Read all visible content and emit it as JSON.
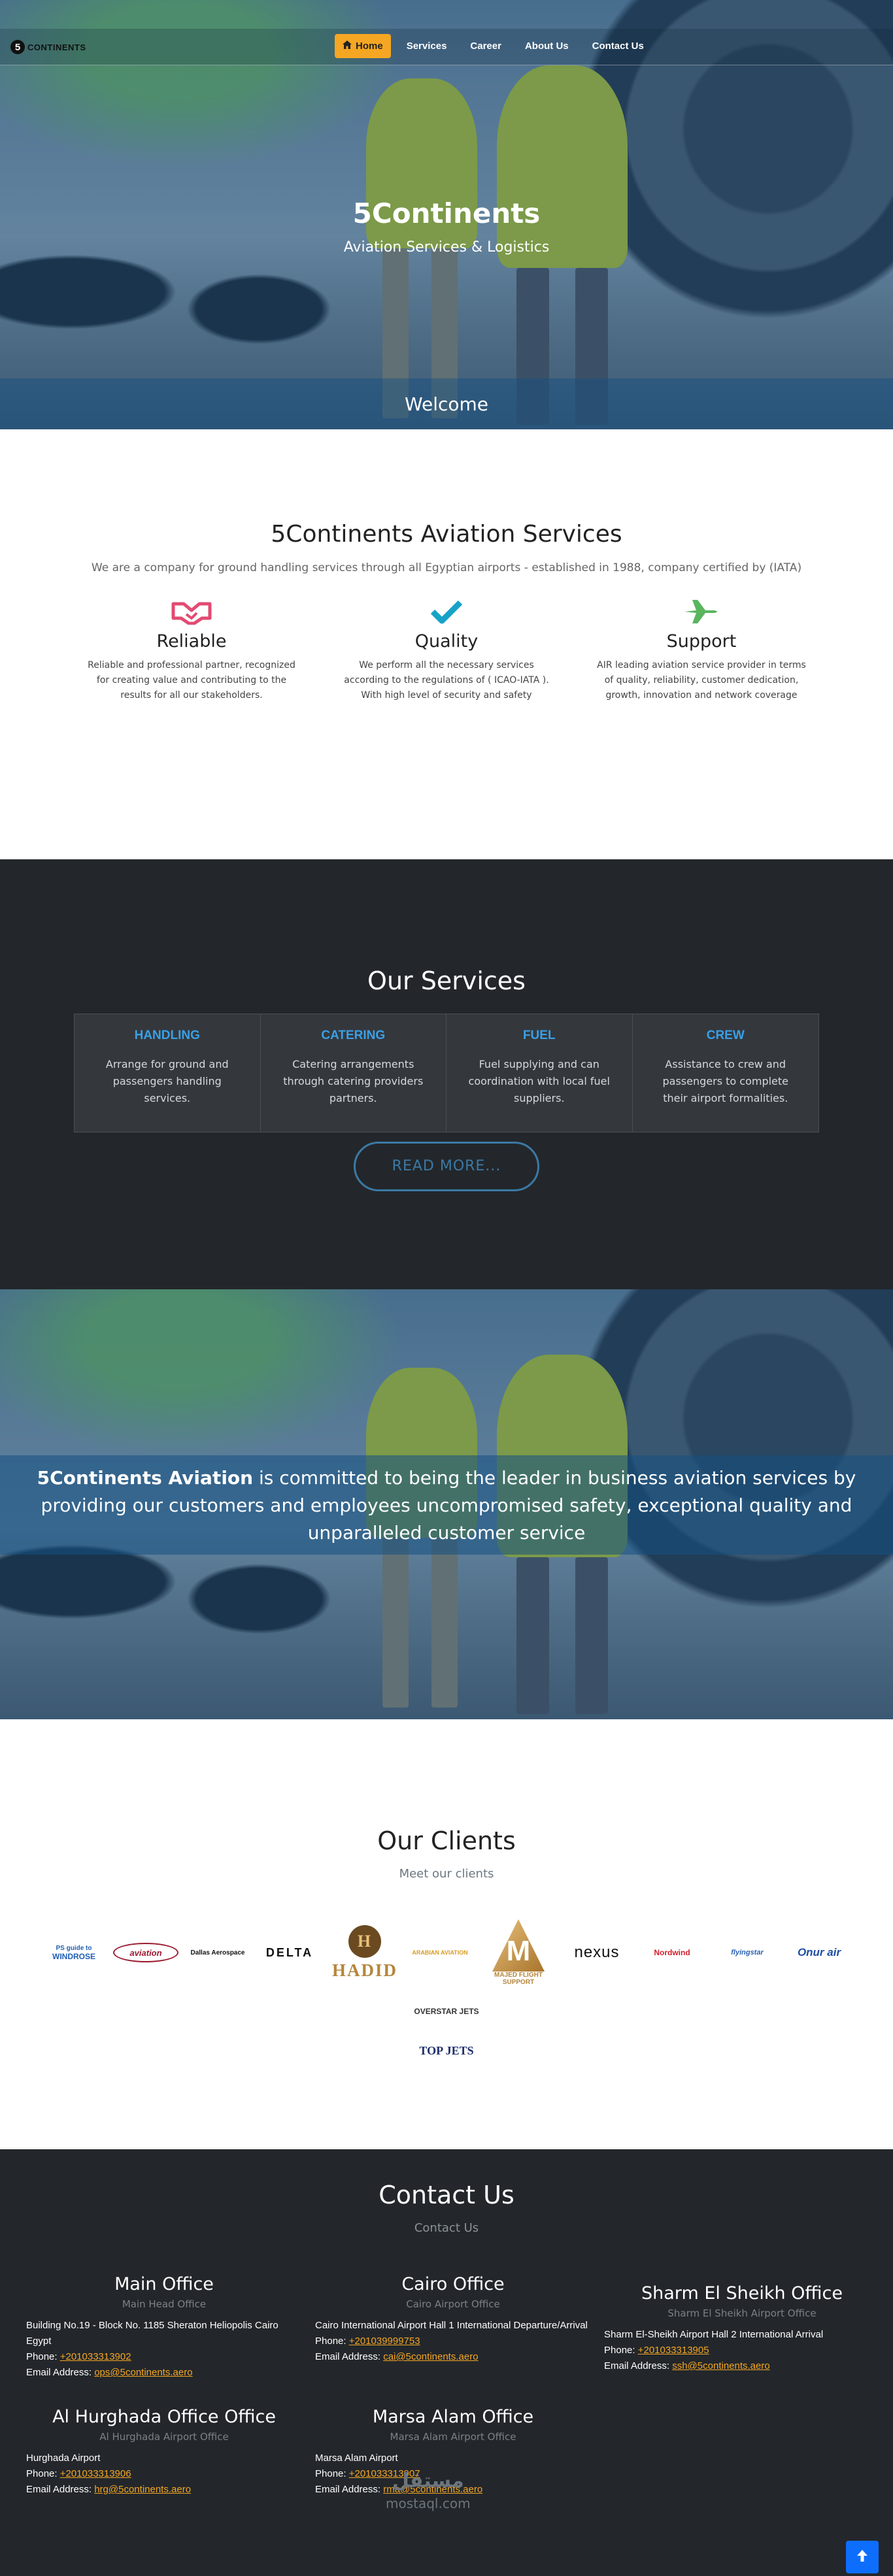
{
  "nav": {
    "logo_mark": "5",
    "logo_text": "CONTINENTS",
    "items": [
      {
        "label": "Home",
        "icon": "home-icon",
        "active": true
      },
      {
        "label": "Services"
      },
      {
        "label": "Career"
      },
      {
        "label": "About Us"
      },
      {
        "label": "Contact Us"
      }
    ]
  },
  "hero": {
    "title": "5Continents",
    "subtitle": "Aviation Services & Logistics",
    "welcome": "Welcome"
  },
  "about": {
    "title": "5Continents Aviation Services",
    "lead": "We are a company for ground handling services through all Egyptian airports - established in 1988, company certified by (IATA)",
    "features": [
      {
        "icon": "handshake-icon",
        "color": "#e24b73",
        "title": "Reliable",
        "text": "Reliable and professional partner, recognized for creating value and contributing to the results for all our stakeholders."
      },
      {
        "icon": "check-icon",
        "color": "#17a2c8",
        "title": "Quality",
        "text": "We perform all the necessary services according to the regulations of ( ICAO-IATA ). With high level of security and safety"
      },
      {
        "icon": "plane-icon",
        "color": "#5ab55e",
        "title": "Support",
        "text": "AIR leading aviation service provider in terms of quality, reliability, customer dedication, growth, innovation and network coverage"
      }
    ]
  },
  "services": {
    "title": "Our Services",
    "items": [
      {
        "title": "HANDLING",
        "text": "Arrange for ground and passengers handling services."
      },
      {
        "title": "CATERING",
        "text": "Catering arrangements through catering providers partners."
      },
      {
        "title": "FUEL",
        "text": "Fuel supplying and can coordination with local fuel suppliers."
      },
      {
        "title": "CREW",
        "text": "Assistance to crew and passengers to complete their airport formalities."
      }
    ],
    "read_more": "READ MORE..."
  },
  "mission": {
    "brand": "5Continents Aviation",
    "text": " is committed to being the leader in business aviation services by providing our customers and employees uncompromised safety, exceptional quality and unparalleled customer service"
  },
  "clients": {
    "title": "Our Clients",
    "subtitle": "Meet our clients",
    "logos": [
      {
        "name": "WINDROSE",
        "caption": "PS guide to",
        "color": "#1f5fb4"
      },
      {
        "name": "aviation",
        "caption": "",
        "color": "#9b1b30"
      },
      {
        "name": "Dallas Aerospace",
        "caption": "",
        "color": "#111111"
      },
      {
        "name": "DELTA",
        "caption": "",
        "color": "#111111"
      },
      {
        "name": "HADID",
        "caption": "H",
        "color": "#b4863c"
      },
      {
        "name": "ARABIAN AVIATION",
        "caption": "",
        "color": "#d99a22"
      },
      {
        "name": "MAJED FLIGHT SUPPORT",
        "caption": "M",
        "color": "#b4863c"
      },
      {
        "name": "nexus",
        "caption": "",
        "color": "#111111"
      },
      {
        "name": "Nordwind",
        "caption": "",
        "color": "#d41f2a"
      },
      {
        "name": "flyingstar",
        "caption": "",
        "color": "#2a62b0"
      },
      {
        "name": "Onur air",
        "caption": "",
        "color": "#1e4ea3"
      },
      {
        "name": "OVERSTAR JETS",
        "caption": "",
        "color": "#333333"
      },
      {
        "name": "TOP JETS",
        "caption": "",
        "color": "#1d2f6b"
      }
    ]
  },
  "contact": {
    "title": "Contact Us",
    "subtitle": "Contact Us",
    "offices": [
      {
        "title": "Main Office",
        "sub": "Main Head Office",
        "address": "Building No.19 - Block No. 1185 Sheraton Heliopolis Cairo Egypt",
        "phone_label": "Phone: ",
        "phone": "+201033313902",
        "email_label": "Email Address: ",
        "email": "ops@5continents.aero"
      },
      {
        "title": "Cairo Office",
        "sub": "Cairo Airport Office",
        "address": "Cairo International Airport Hall 1 International Departure/Arrival",
        "phone_label": "Phone: ",
        "phone": "+201039999753",
        "email_label": "Email Address: ",
        "email": "cai@5continents.aero"
      },
      {
        "title": "Sharm El Sheikh Office",
        "sub": "Sharm El Sheikh Airport Office",
        "address": "Sharm El-Sheikh Airport Hall 2 International Arrival",
        "phone_label": "Phone: ",
        "phone": "+201033313905",
        "email_label": "Email Address: ",
        "email": "ssh@5continents.aero"
      },
      {
        "title": "Al Hurghada Office Office",
        "sub": "Al Hurghada Airport Office",
        "address": "Hurghada Airport",
        "phone_label": "Phone: ",
        "phone": "+201033313906",
        "email_label": "Email Address: ",
        "email": "hrg@5continents.aero"
      },
      {
        "title": "Marsa Alam Office",
        "sub": "Marsa Alam Airport Office",
        "address": "Marsa Alam Airport",
        "phone_label": "Phone: ",
        "phone": "+201033313907",
        "email_label": "Email Address: ",
        "email": "rma@5continents.aero"
      }
    ]
  },
  "watermark": {
    "line1": "مستقل",
    "line2": "mostaql.com"
  }
}
